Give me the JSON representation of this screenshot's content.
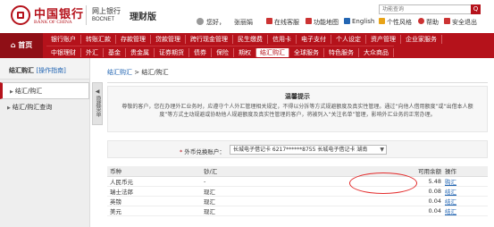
{
  "header": {
    "bank_name_cn": "中国银行",
    "bank_name_en": "BANK OF CHINA",
    "netbank_cn": "网上银行",
    "netbank_en": "BOCNET",
    "edition": "理财版",
    "greeting": "您好，",
    "username": "张丽娟",
    "links": [
      "在线客服",
      "功能地图",
      "English",
      "个性风格",
      "帮助",
      "安全退出"
    ],
    "search_placeholder": "功能查询",
    "search_button": "Q"
  },
  "nav": {
    "home": "首页",
    "top": [
      "银行账户",
      "转账汇款",
      "存款管理",
      "贷款管理",
      "跨行现金管理",
      "民生缴费",
      "信用卡",
      "电子支付",
      "个人设定",
      "资产管理",
      "企业家服务"
    ],
    "bottom": [
      "中银理财",
      "外汇",
      "基金",
      "贵金属",
      "证券期货",
      "债券",
      "保险",
      "期权",
      "结汇购汇",
      "全球服务",
      "特色服务",
      "大众商品"
    ],
    "active_bottom_index": 8
  },
  "sidebar": {
    "title": "结汇购汇",
    "guide": "[操作指南]",
    "items": [
      {
        "label": "结汇/购汇",
        "active": true
      },
      {
        "label": "结汇/购汇查询",
        "active": false
      }
    ],
    "collapse_label": "隐藏菜单"
  },
  "breadcrumb": {
    "root": "结汇购汇",
    "sep": " > ",
    "current": "结汇/购汇"
  },
  "notice": {
    "title": "温馨提示",
    "body": "尊敬的客户，您在办理外汇业务时，应遵守个人外汇管理相关规定，不得以分拆等方式规避额度及真实性管理。通过“向他人借用额度”或“出借本人额度”等方式主动规避或协助他人规避额度及真实性管理的客户，将被列入“关注名单”管理，影响外汇业务的正常办理。"
  },
  "account": {
    "required_mark": "*",
    "label": "外币兑换账户：",
    "selected": "长城电子借记卡 6217******8755 长城电子借记卡 湖南",
    "arrow": "▼"
  },
  "table": {
    "headers": [
      "币种",
      "钞/汇",
      "可用余额",
      "操作"
    ],
    "rows": [
      {
        "currency": "人民币元",
        "cash_remit": "-",
        "balance": "5.48",
        "action": "购汇"
      },
      {
        "currency": "瑞士法郎",
        "cash_remit": "现汇",
        "balance": "0.08",
        "action": "结汇"
      },
      {
        "currency": "英镑",
        "cash_remit": "现汇",
        "balance": "0.04",
        "action": "结汇"
      },
      {
        "currency": "美元",
        "cash_remit": "现汇",
        "balance": "0.04",
        "action": "结汇"
      }
    ]
  },
  "colors": {
    "brand_red": "#b5121b",
    "link_blue": "#2366b3",
    "annotation_red": "#e32b2b"
  }
}
